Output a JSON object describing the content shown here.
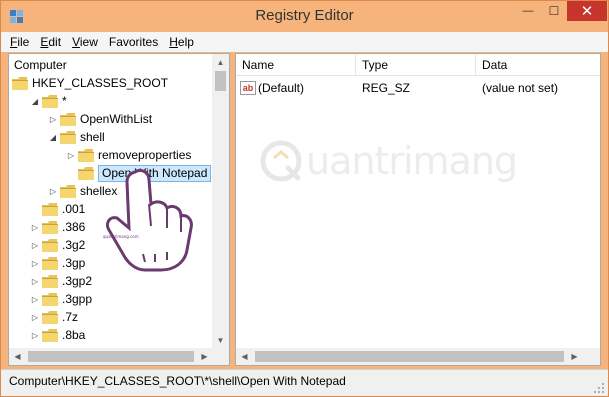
{
  "window": {
    "title": "Registry Editor",
    "close_glyph": "✕",
    "minimize_glyph": "—",
    "maximize_glyph": "☐"
  },
  "menu": {
    "items": [
      {
        "label": "File",
        "accel": "F",
        "rest": "ile"
      },
      {
        "label": "Edit",
        "accel": "E",
        "rest": "dit"
      },
      {
        "label": "View",
        "accel": "V",
        "rest": "iew"
      },
      {
        "label": "Favorites",
        "accel": "",
        "rest": "Favorites"
      },
      {
        "label": "Help",
        "accel": "H",
        "rest": "elp"
      }
    ]
  },
  "tree": {
    "items": [
      {
        "label": "Computer",
        "level": 0,
        "expander": "",
        "folder": false
      },
      {
        "label": "HKEY_CLASSES_ROOT",
        "level": 0,
        "expander": "",
        "folder": true
      },
      {
        "label": "*",
        "level": 1,
        "expander": "expanded",
        "folder": true
      },
      {
        "label": "OpenWithList",
        "level": 2,
        "expander": "collapsed",
        "folder": true
      },
      {
        "label": "shell",
        "level": 2,
        "expander": "expanded",
        "folder": true
      },
      {
        "label": "removeproperties",
        "level": 3,
        "expander": "collapsed",
        "folder": true
      },
      {
        "label": "Open With Notepad",
        "level": 3,
        "expander": "",
        "folder": true,
        "selected": true
      },
      {
        "label": "shellex",
        "level": 2,
        "expander": "collapsed",
        "folder": true
      },
      {
        "label": ".001",
        "level": 1,
        "expander": "",
        "folder": true
      },
      {
        "label": ".386",
        "level": 1,
        "expander": "collapsed",
        "folder": true
      },
      {
        "label": ".3g2",
        "level": 1,
        "expander": "collapsed",
        "folder": true
      },
      {
        "label": ".3gp",
        "level": 1,
        "expander": "collapsed",
        "folder": true
      },
      {
        "label": ".3gp2",
        "level": 1,
        "expander": "collapsed",
        "folder": true
      },
      {
        "label": ".3gpp",
        "level": 1,
        "expander": "collapsed",
        "folder": true
      },
      {
        "label": ".7z",
        "level": 1,
        "expander": "collapsed",
        "folder": true
      },
      {
        "label": ".8ba",
        "level": 1,
        "expander": "collapsed",
        "folder": true
      }
    ]
  },
  "list": {
    "columns": [
      "Name",
      "Type",
      "Data"
    ],
    "rows": [
      {
        "name": "(Default)",
        "type": "REG_SZ",
        "data": "(value not set)",
        "icon": "ab-string-icon"
      }
    ]
  },
  "status": {
    "path": "Computer\\HKEY_CLASSES_ROOT\\*\\shell\\Open With Notepad"
  },
  "watermark": {
    "text": "uantrimang",
    "logo_icon": "quantrimang-logo-icon"
  },
  "colors": {
    "titlebar": "#f6b47c",
    "close_button": "#c7342b",
    "selection": "#cce8ff",
    "folder": "#e8c35a"
  }
}
